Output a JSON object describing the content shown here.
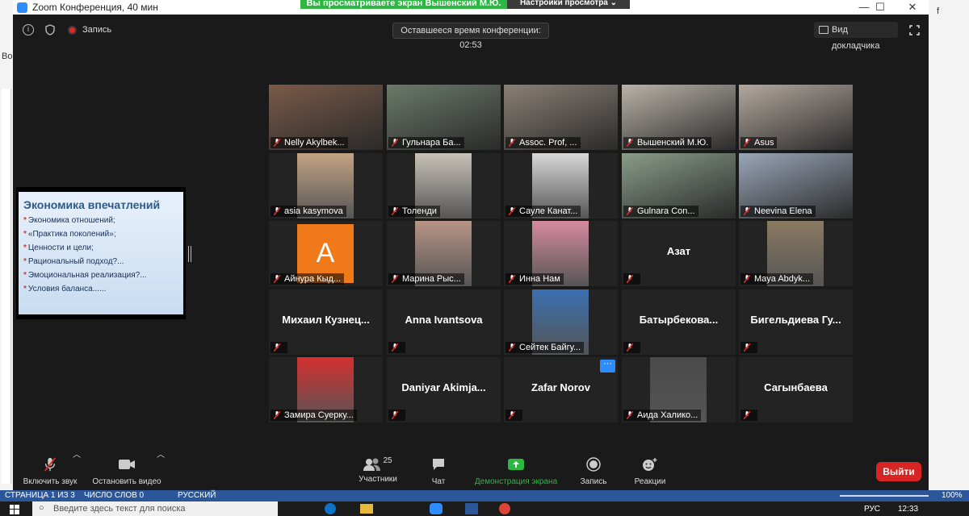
{
  "window": {
    "title": "Zoom Конференция, 40 мин",
    "minimize": "—",
    "maximize": "☐",
    "close": "✕"
  },
  "banner": {
    "sharing_text": "Вы просматриваете экран Вышенский М.Ю.",
    "view_options": "Настройки просмотра ⌄"
  },
  "header": {
    "record_label": "Запись",
    "timer": "Оставшееся время конференции: 02:53",
    "speaker_view": "Вид докладчика",
    "info_icon": "i"
  },
  "word_behind": {
    "left_fragment": "Во",
    "right_fragment": "f"
  },
  "slide": {
    "title": "Экономика впечатлений",
    "items": [
      "Экономика отношений;",
      "«Практика поколений»;",
      "Ценности и цели;",
      "Рациональный подход?...",
      "Эмоциональная реализация?...",
      "Условия баланса......"
    ]
  },
  "participants": [
    {
      "name": "Nelly Akylbek...",
      "type": "video",
      "color": "#7a5a48"
    },
    {
      "name": "Гульнара Ба...",
      "type": "video",
      "color": "#6b7a6a"
    },
    {
      "name": "Assoc. Prof, ...",
      "type": "video",
      "color": "#8a8076"
    },
    {
      "name": "Вышенский М.Ю.",
      "type": "video",
      "color": "#b9b3a8",
      "active": true
    },
    {
      "name": "Asus",
      "type": "video",
      "color": "#b3a89e"
    },
    {
      "name": "asia kasymova",
      "type": "photo",
      "color": "#c4a384"
    },
    {
      "name": "Толенди",
      "type": "photo",
      "color": "#c8c2b8"
    },
    {
      "name": "Сауле Канат...",
      "type": "photo",
      "color": "#d8d8d8"
    },
    {
      "name": "Gulnara Con...",
      "type": "video",
      "color": "#8a9c8a"
    },
    {
      "name": "Neevina Elena",
      "type": "video",
      "color": "#9aa6b8"
    },
    {
      "name": "Айнура Кыд...",
      "type": "avatar",
      "letter": "А"
    },
    {
      "name": "Марина Рыс...",
      "type": "photo",
      "color": "#b89484"
    },
    {
      "name": "Инна Нам",
      "type": "photo",
      "color": "#d68aa0"
    },
    {
      "name": "Азат",
      "type": "name",
      "label": ""
    },
    {
      "name": "Maya Abdyk...",
      "type": "photo",
      "color": "#8a7a62"
    },
    {
      "name": "Михаил Кузнец...",
      "type": "name",
      "label": ""
    },
    {
      "name": "Anna Ivantsova",
      "type": "name",
      "label": ""
    },
    {
      "name": "Сейтек Байгу...",
      "type": "photo",
      "color": "#3a6fb0"
    },
    {
      "name": "Батырбекова...",
      "type": "name",
      "label": ""
    },
    {
      "name": "Бигельдиева Гу...",
      "type": "name",
      "label": ""
    },
    {
      "name": "Замира Суерку...",
      "type": "photo",
      "color": "#d43030"
    },
    {
      "name": "Daniyar Akimja...",
      "type": "name",
      "label": ""
    },
    {
      "name": "Zafar Norov",
      "type": "name",
      "label": "",
      "more": "···"
    },
    {
      "name": "Аида Халико...",
      "type": "photo",
      "color": "#4a4a4a"
    },
    {
      "name": "Сагынбаева",
      "type": "name",
      "label": ""
    }
  ],
  "toolbar": {
    "unmute": "Включить звук",
    "stop_video": "Остановить видео",
    "participants": "Участники",
    "participants_count": "25",
    "chat": "Чат",
    "share_screen": "Демонстрация экрана",
    "record": "Запись",
    "reactions": "Реакции",
    "end": "Выйти"
  },
  "statusbar": {
    "page": "СТРАНИЦА 1 ИЗ 3",
    "words": "ЧИСЛО СЛОВ 0",
    "language": "РУССКИЙ",
    "zoom": "100%"
  },
  "taskbar": {
    "search_placeholder": "Введите здесь текст для поиска",
    "time": "12:33",
    "lang": "РУС"
  },
  "colors": {
    "share_green": "#2db742",
    "end_red": "#d92424",
    "active_border": "#c9e34a",
    "zoom_blue": "#2d8cff"
  }
}
